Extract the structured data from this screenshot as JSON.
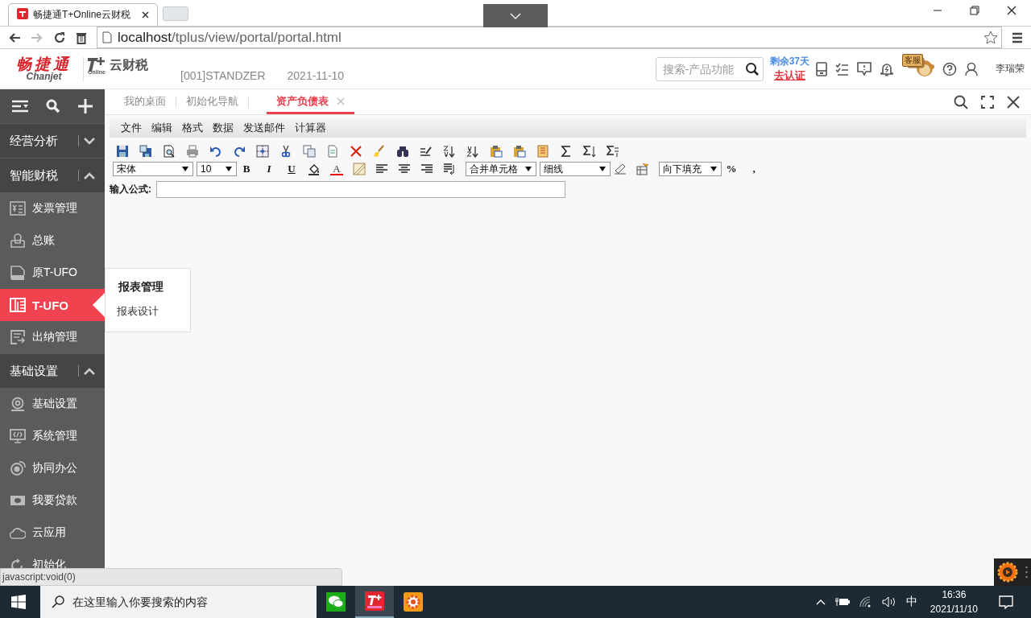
{
  "browser": {
    "tab_title": "畅捷通T+Online云财税",
    "url_host": "localhost",
    "url_path": "/tplus/view/portal/portal.html"
  },
  "header": {
    "logo_cn": "畅捷通",
    "logo_en": "Chanjet",
    "product": "云财税",
    "product_badge": "Online",
    "account": "[001]STANDZER",
    "date": "2021-11-10",
    "search": {
      "placeholder": "搜索-产品功能"
    },
    "trial": "剩余37天",
    "verify_link": "去认证",
    "mascot_sign": "客服",
    "user": "李瑞荣"
  },
  "sidebar": {
    "groups": [
      {
        "label": "经营分析",
        "expanded": false
      },
      {
        "label": "智能财税",
        "expanded": true,
        "children": [
          {
            "label": "发票管理",
            "selected": false
          },
          {
            "label": "总账",
            "selected": false
          },
          {
            "label": "原T-UFO",
            "selected": false
          },
          {
            "label": "T-UFO",
            "selected": true
          },
          {
            "label": "出纳管理",
            "selected": false
          }
        ]
      },
      {
        "label": "基础设置",
        "expanded": true,
        "children": [
          {
            "label": "基础设置",
            "selected": false
          },
          {
            "label": "系统管理",
            "selected": false
          },
          {
            "label": "协同办公",
            "selected": false
          },
          {
            "label": "我要贷款",
            "selected": false
          },
          {
            "label": "云应用",
            "selected": false
          },
          {
            "label": "初始化",
            "selected": false
          }
        ]
      }
    ]
  },
  "tabs": [
    {
      "label": "我的桌面",
      "selected": false
    },
    {
      "label": "初始化导航",
      "selected": false
    },
    {
      "label": "资产负债表",
      "selected": true
    }
  ],
  "menu": [
    "文件",
    "编辑",
    "格式",
    "数据",
    "发送邮件",
    "计算器"
  ],
  "format_bar": {
    "font": "宋体",
    "size": "10",
    "bold": "B",
    "italic": "I",
    "underline": "U",
    "font_color": "A",
    "merge": "合并单元格",
    "border": "细线",
    "fill": "向下填充",
    "percent": "%",
    "comma": ","
  },
  "formula": {
    "label": "输入公式:"
  },
  "popup": {
    "title": "报表管理",
    "items": [
      "报表设计"
    ]
  },
  "status_tip": "javascript:void(0)",
  "taskbar": {
    "search_placeholder": "在这里输入你要搜索的内容",
    "ime": "中",
    "time": "16:36",
    "date": "2021/11/10"
  }
}
